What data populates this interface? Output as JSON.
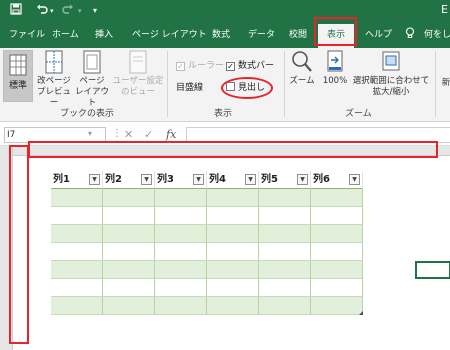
{
  "titlebar": {
    "save_icon": "save-icon",
    "undo_icon": "undo-icon",
    "redo_icon": "redo-icon",
    "customize_icon": "chevron-down-icon",
    "right_text": "E"
  },
  "tabs": [
    {
      "label": "ファイル"
    },
    {
      "label": "ホーム"
    },
    {
      "label": "挿入"
    },
    {
      "label": "ページ レイアウト"
    },
    {
      "label": "数式"
    },
    {
      "label": "データ"
    },
    {
      "label": "校閲"
    },
    {
      "label": "表示",
      "active": true
    },
    {
      "label": "ヘルプ"
    },
    {
      "label": "何をし"
    }
  ],
  "ribbon": {
    "workbook_views": {
      "label": "ブックの表示",
      "normal": "標準",
      "page_break_1": "改ページ",
      "page_break_2": "プレビュー",
      "page_layout_1": "ページ",
      "page_layout_2": "レイアウト",
      "custom_1": "ユーザー設定",
      "custom_2": "のビュー"
    },
    "show": {
      "label": "表示",
      "ruler": "ルーラー",
      "formula_bar": "数式バー",
      "gridlines": "目盛線",
      "headings": "見出し"
    },
    "zoom": {
      "label": "ズーム",
      "zoom": "ズーム",
      "hundred": "100%",
      "fit_1": "選択範囲に合わせて",
      "fit_2": "拡大/縮小"
    },
    "new_window": "新"
  },
  "formula_bar": {
    "name_box": "I7",
    "cancel_icon": "✕",
    "enter_icon": "✓",
    "fx": "fx",
    "value": ""
  },
  "table": {
    "headers": [
      "列1",
      "列2",
      "列3",
      "列4",
      "列5",
      "列6"
    ],
    "row_count": 7
  },
  "colors": {
    "accent": "#217346",
    "highlight": "#e8232b",
    "band": "#e2efda"
  }
}
